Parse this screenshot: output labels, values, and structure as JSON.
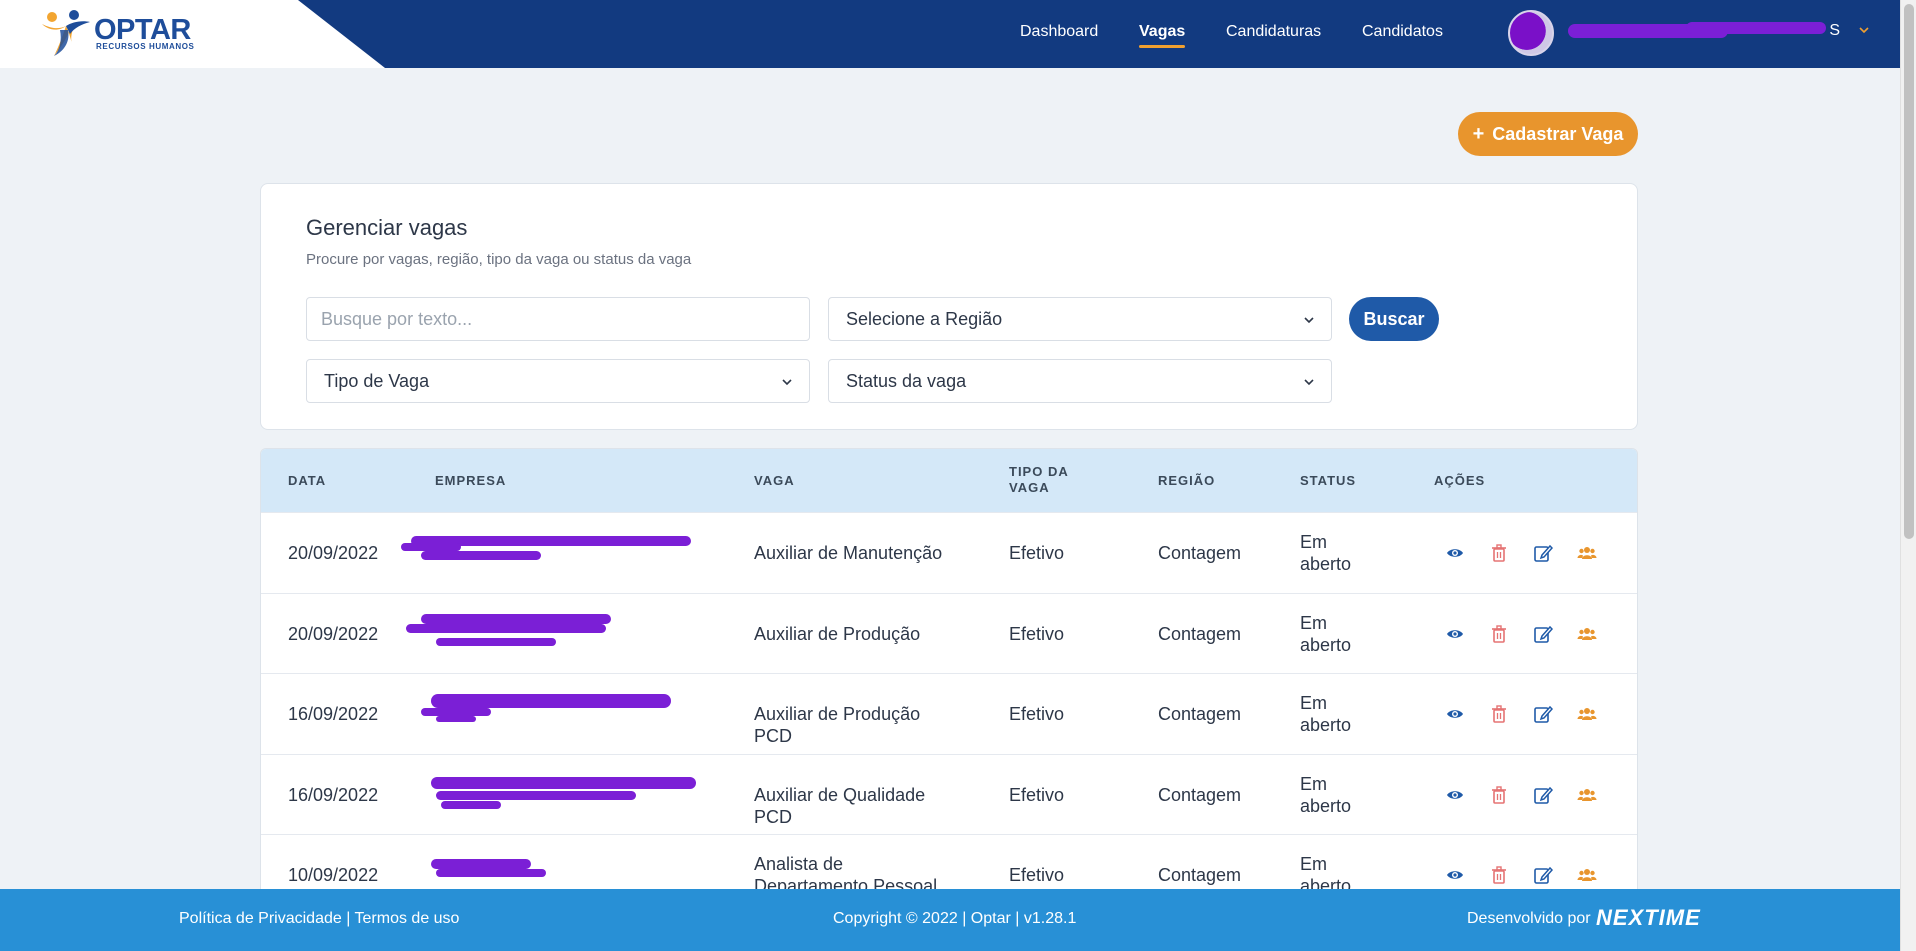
{
  "brand": {
    "name": "OPTAR",
    "tagline": "RECURSOS HUMANOS"
  },
  "nav": {
    "items": [
      {
        "label": "Dashboard",
        "active": false
      },
      {
        "label": "Vagas",
        "active": true
      },
      {
        "label": "Candidaturas",
        "active": false
      },
      {
        "label": "Candidatos",
        "active": false
      }
    ]
  },
  "user": {
    "name_suffix": "S",
    "avatar_icon": "user-avatar"
  },
  "actions": {
    "add_job_label": "Cadastrar Vaga"
  },
  "filters": {
    "title": "Gerenciar vagas",
    "subtitle": "Procure por vagas, região, tipo da vaga ou status da vaga",
    "search_placeholder": "Busque por texto...",
    "region_select": "Selecione a Região",
    "type_select": "Tipo de Vaga",
    "status_select": "Status da vaga",
    "search_button": "Buscar"
  },
  "table": {
    "headers": [
      "DATA",
      "EMPRESA",
      "VAGA",
      "TIPO DA VAGA",
      "REGIÃO",
      "STATUS",
      "AÇÕES"
    ],
    "rows": [
      {
        "date": "20/09/2022",
        "vacancy": "Auxiliar de Manutenção",
        "type": "Efetivo",
        "region": "Contagem",
        "status": "Em aberto"
      },
      {
        "date": "20/09/2022",
        "vacancy": "Auxiliar de Produção",
        "type": "Efetivo",
        "region": "Contagem",
        "status": "Em aberto"
      },
      {
        "date": "16/09/2022",
        "vacancy": "Auxiliar de Produção PCD",
        "type": "Efetivo",
        "region": "Contagem",
        "status": "Em aberto"
      },
      {
        "date": "16/09/2022",
        "vacancy": "Auxiliar de Qualidade PCD",
        "type": "Efetivo",
        "region": "Contagem",
        "status": "Em aberto"
      },
      {
        "date": "10/09/2022",
        "vacancy": "Analista de Departamento Pessoal",
        "type": "Efetivo",
        "region": "Contagem",
        "status": "Em aberto"
      }
    ]
  },
  "footer": {
    "legal": "Política de Privacidade | Termos de uso",
    "copyright": "Copyright © 2022 | Optar | v1.28.1",
    "developed_by": "Desenvolvido por",
    "developer_logo": "NEXTIME"
  },
  "colors": {
    "header_bg": "#123a80",
    "accent_orange": "#e8952d",
    "primary_blue": "#1f5aa8",
    "table_header_bg": "#d4e8f8",
    "footer_bg": "#2890d6",
    "delete_red": "#e57373"
  }
}
